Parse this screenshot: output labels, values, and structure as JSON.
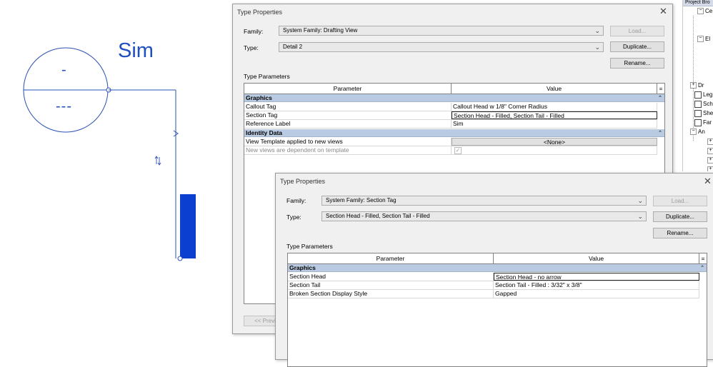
{
  "canvas": {
    "sim_label": "Sim",
    "head_top_text": "-",
    "head_bottom_text": "---",
    "colors": {
      "line": "#2b50b5",
      "tail_fill": "#0a3fcf"
    }
  },
  "browser": {
    "header": "Project Bro",
    "items": [
      "Ce",
      "El",
      "Dr",
      "Leg",
      "Sch",
      "She",
      "Far",
      "An"
    ]
  },
  "dialog1": {
    "title": "Type Properties",
    "family_label": "Family:",
    "family_value": "System Family: Drafting View",
    "type_label": "Type:",
    "type_value": "Detail 2",
    "load_btn": "Load...",
    "duplicate_btn": "Duplicate...",
    "rename_btn": "Rename...",
    "params_label": "Type Parameters",
    "col_parameter": "Parameter",
    "col_value": "Value",
    "col_extra": "=",
    "groups": [
      {
        "name": "Graphics",
        "caret": "⌃",
        "rows": [
          {
            "param": "Callout Tag",
            "value": "Callout Head w 1/8\" Corner Radius"
          },
          {
            "param": "Section Tag",
            "value": "Section Head - Filled, Section Tail - Filled"
          },
          {
            "param": "Reference Label",
            "value": "Sim"
          }
        ]
      },
      {
        "name": "Identity Data",
        "caret": "⌃",
        "rows": [
          {
            "param": "View Template applied to new views",
            "value": "<None>"
          },
          {
            "param": "New views are dependent on template",
            "value": "✓"
          }
        ]
      }
    ],
    "preview_btn": "<< Previ"
  },
  "dialog2": {
    "title": "Type Properties",
    "family_label": "Family:",
    "family_value": "System Family: Section Tag",
    "type_label": "Type:",
    "type_value": "Section Head - Filled, Section Tail - Filled",
    "load_btn": "Load...",
    "duplicate_btn": "Duplicate...",
    "rename_btn": "Rename...",
    "params_label": "Type Parameters",
    "col_parameter": "Parameter",
    "col_value": "Value",
    "col_extra": "=",
    "groups": [
      {
        "name": "Graphics",
        "caret": "⌃",
        "rows": [
          {
            "param": "Section Head",
            "value": "Section Head - no arrow"
          },
          {
            "param": "Section Tail",
            "value": "Section Tail - Filled : 3/32\" x 3/8\""
          },
          {
            "param": "Broken Section Display Style",
            "value": "Gapped"
          }
        ]
      }
    ]
  },
  "icons": {
    "close": "✕",
    "chevron": "⌄",
    "collapse": "⌃",
    "minus": "−",
    "plus": "+"
  }
}
